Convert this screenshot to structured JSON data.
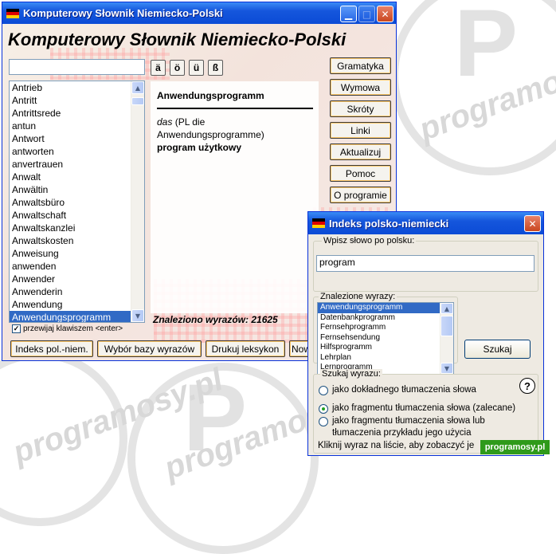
{
  "watermark": {
    "text": "programosy.pl",
    "letter": "P"
  },
  "main_window": {
    "title": "Komputerowy Słownik Niemiecko-Polski",
    "app_title": "Komputerowy Słownik Niemiecko-Polski",
    "search_value": "",
    "special_chars": [
      "ä",
      "ö",
      "ü",
      "ß"
    ],
    "word_list": [
      "Antrieb",
      "Antritt",
      "Antrittsrede",
      "antun",
      "Antwort",
      "antworten",
      "anvertrauen",
      "Anwalt",
      "Anwältin",
      "Anwaltsbüro",
      "Anwaltschaft",
      "Anwaltskanzlei",
      "Anwaltskosten",
      "Anweisung",
      "anwenden",
      "Anwender",
      "Anwenderin",
      "Anwendung",
      "Anwendungsprogramm"
    ],
    "selected_word": "Anwendungsprogramm",
    "scroll_checkbox": {
      "label": "przewijaj klawiszem <enter>",
      "checked": true
    },
    "side_buttons": [
      "Gramatyka",
      "Wymowa",
      "Skróty",
      "Linki",
      "Aktualizuj",
      "Pomoc",
      "O programie"
    ],
    "definition": {
      "headword": "Anwendungsprogramm",
      "article": "das",
      "plural": " (PL die Anwendungsprogramme)",
      "translation": "program użytkowy"
    },
    "found_label": "Znaleziono wyrazów: 21625",
    "bottom_buttons": [
      "Indeks pol.-niem.",
      "Wybór bazy wyrazów",
      "Drukuj leksykon",
      "Now"
    ]
  },
  "dialog": {
    "title": "Indeks polsko-niemiecki",
    "input_label": "Wpisz słowo po polsku:",
    "input_value": "program",
    "found_label": "Znalezione wyrazy:",
    "found_items": [
      "Anwendungsprogramm",
      "Datenbankprogramm",
      "Fernsehprogramm",
      "Fernsehsendung",
      "Hilfsprogramm",
      "Lehrplan",
      "Lernprogramm"
    ],
    "search_button": "Szukaj",
    "search_group_label": "Szukaj wyrazu:",
    "radio_exact": "jako dokładnego tłumaczenia słowa",
    "radio_fragment": "jako fragmentu tłumaczenia słowa (zalecane)",
    "radio_fragment_example_1": "jako fragmentu tłumaczenia słowa lub",
    "radio_fragment_example_2": "tłumaczenia przykładu jego użycia",
    "help_label": "?",
    "status_text": "Kliknij wyraz na liście, aby zobaczyć je"
  },
  "brand_badge": "programosy.pl",
  "colors": {
    "titlebar": "#0b4bd6",
    "selection": "#316ac5",
    "brand": "#2f9a1a"
  }
}
